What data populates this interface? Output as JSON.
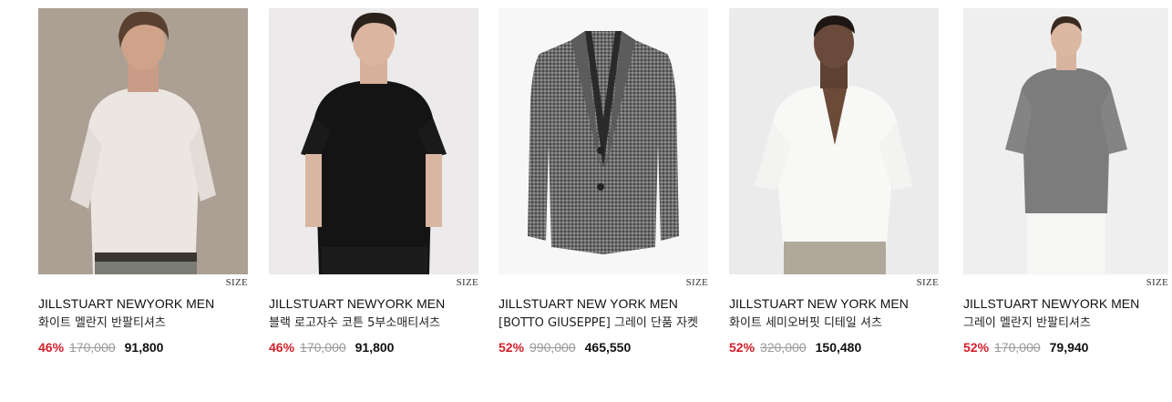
{
  "products": [
    {
      "brand": "JILLSTUART NEWYORK MEN",
      "name": "화이트 멜란지 반팔티셔츠",
      "discount": "46%",
      "original_price": "170,000",
      "sale_price": "91,800",
      "size_label": "SIZE"
    },
    {
      "brand": "JILLSTUART NEWYORK MEN",
      "name": "블랙 로고자수 코튼 5부소매티셔츠",
      "discount": "46%",
      "original_price": "170,000",
      "sale_price": "91,800",
      "size_label": "SIZE"
    },
    {
      "brand": "JILLSTUART NEW YORK MEN",
      "name": "[BOTTO GIUSEPPE] 그레이 단품 자켓",
      "discount": "52%",
      "original_price": "990,000",
      "sale_price": "465,550",
      "size_label": "SIZE"
    },
    {
      "brand": "JILLSTUART NEW YORK MEN",
      "name": "화이트 세미오버핏 디테일 셔츠",
      "discount": "52%",
      "original_price": "320,000",
      "sale_price": "150,480",
      "size_label": "SIZE"
    },
    {
      "brand": "JILLSTUART NEWYORK MEN",
      "name": "그레이 멜란지 반팔티셔츠",
      "discount": "52%",
      "original_price": "170,000",
      "sale_price": "79,940",
      "size_label": "SIZE"
    }
  ],
  "colors": {
    "discount": "#d3202a",
    "original_price": "#9a9a9a"
  }
}
